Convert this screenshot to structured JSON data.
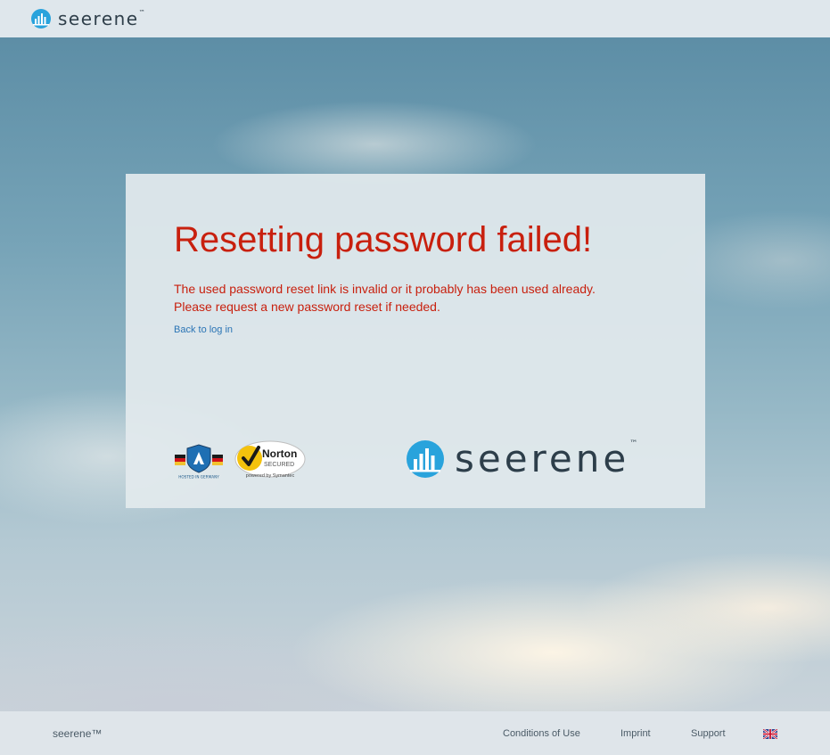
{
  "header": {
    "logo_text": "seerene",
    "logo_tm": "™"
  },
  "card": {
    "title": "Resetting password failed!",
    "message_line1": "The used password reset link is invalid or it probably has been used already.",
    "message_line2": "Please request a new password reset if needed.",
    "back_link": "Back to log in",
    "badges": {
      "germany": {
        "text": "HOSTED IN GERMANY"
      },
      "norton": {
        "title": "Norton",
        "subtitle": "SECURED",
        "powered": "powered by Symantec"
      }
    },
    "logo_text": "seerene",
    "logo_tm": "™"
  },
  "footer": {
    "copyright": "seerene™",
    "links": {
      "conditions": "Conditions of Use",
      "imprint": "Imprint",
      "support": "Support"
    },
    "language_icon": "uk-flag-icon"
  },
  "colors": {
    "title_red": "#c8200e",
    "link_blue": "#2a74b5",
    "brand_blue": "#29a3dc",
    "brand_dark": "#2d3e4a"
  }
}
